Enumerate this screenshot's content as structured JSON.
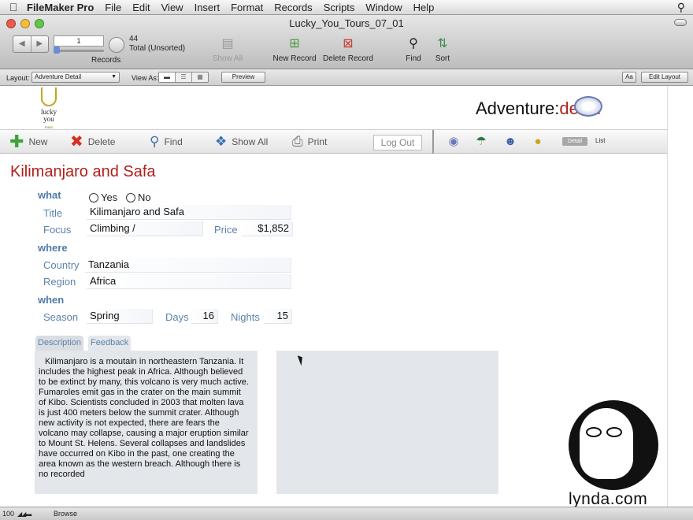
{
  "menubar": {
    "apple_icon": "apple-icon",
    "app_name": "FileMaker Pro",
    "items": [
      "File",
      "Edit",
      "View",
      "Insert",
      "Format",
      "Records",
      "Scripts",
      "Window",
      "Help"
    ]
  },
  "window": {
    "title": "Lucky_You_Tours_07_01",
    "traffic_light_colors": [
      "#ee5a4f",
      "#f4be3a",
      "#63c646"
    ]
  },
  "toolbar": {
    "record_number": "1",
    "record_count": "44",
    "record_status": "Total (Unsorted)",
    "records_label": "Records",
    "show_all": "Show All",
    "new_record": "New Record",
    "delete_record": "Delete Record",
    "find": "Find",
    "sort": "Sort"
  },
  "layoutbar": {
    "layout_label": "Layout:",
    "layout_value": "Adventure Detail",
    "view_as_label": "View As:",
    "preview": "Preview",
    "aa": "Aa",
    "edit_layout": "Edit Layout"
  },
  "header": {
    "logo_lines": [
      "lucky",
      "you",
      "tours"
    ],
    "title_prefix": "Adventure:",
    "title_accent": "detail",
    "accent_color": "#b11f1a"
  },
  "actions": {
    "new": "New",
    "delete": "Delete",
    "find": "Find",
    "show_all": "Show All",
    "print": "Print",
    "logout": "Log Out",
    "detail": "Detail",
    "list": "List"
  },
  "record": {
    "heading": "Kilimanjaro and Safa",
    "sections": {
      "what": "what",
      "where": "where",
      "when": "when"
    },
    "radio_yes": "Yes",
    "radio_no": "No",
    "labels": {
      "title": "Title",
      "focus": "Focus",
      "price": "Price",
      "country": "Country",
      "region": "Region",
      "season": "Season",
      "days": "Days",
      "nights": "Nights"
    },
    "values": {
      "title": "Kilimanjaro and Safa",
      "focus": "Climbing /",
      "price": "$1,852",
      "country": "Tanzania",
      "region": "Africa",
      "season": "Spring",
      "days": "16",
      "nights": "15"
    },
    "tabs": [
      "Description",
      "Feedback"
    ],
    "description": "Kilimanjaro is a moutain in northeastern Tanzania. It includes the highest peak in Africa. Although believed to be extinct by many, this volcano is very much active. Fumaroles emit gas in the crater on the main summit of Kibo. Scientists concluded in 2003 that molten lava is just 400 meters below the summit crater. Although new activity is not expected, there are fears the volcano may collapse, causing a major eruption similar to Mount St. Helens. Several collapses and landslides have occurred on Kibo in the past, one creating the area known as the western breach. Although there is no recorded"
  },
  "statusbar": {
    "zoom": "100",
    "mode": "Browse"
  },
  "watermark": "lynda.com"
}
